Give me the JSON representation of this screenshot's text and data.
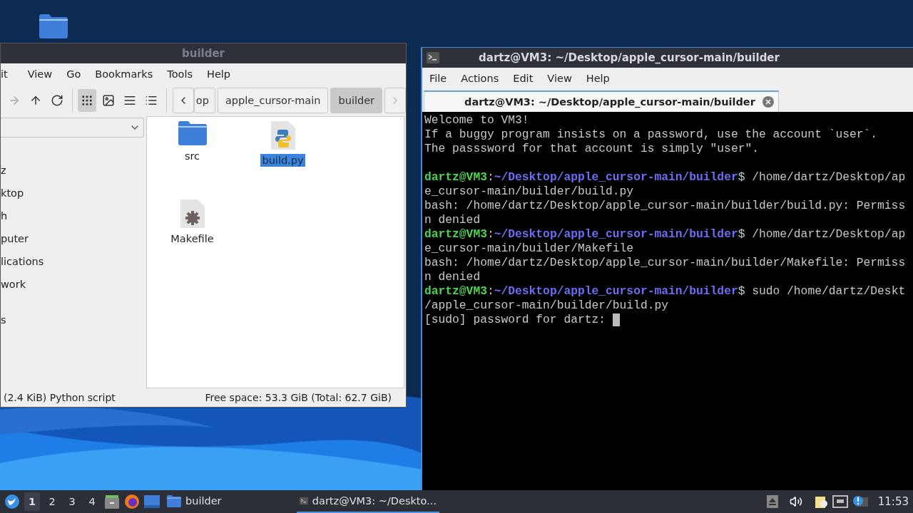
{
  "file_manager": {
    "title": "builder",
    "menu": [
      "it",
      "View",
      "Go",
      "Bookmarks",
      "Tools",
      "Help"
    ],
    "view_modes": [
      {
        "kind": "icons",
        "selected": true
      },
      {
        "kind": "thumbnails",
        "selected": false
      },
      {
        "kind": "list",
        "selected": false
      },
      {
        "kind": "compact",
        "selected": false
      }
    ],
    "path": [
      {
        "label": "op",
        "selected": false
      },
      {
        "label": "apple_cursor-main",
        "selected": false
      },
      {
        "label": "builder",
        "selected": true
      }
    ],
    "sidebar": {
      "items": [
        "z",
        "ktop",
        "h",
        "puter",
        "lications",
        "work",
        "s"
      ]
    },
    "files": [
      {
        "name": "src",
        "kind": "folder",
        "selected": false
      },
      {
        "name": "build.py",
        "kind": "python",
        "selected": true
      },
      {
        "name": "Makefile",
        "kind": "makefile",
        "selected": false
      }
    ],
    "status": {
      "left": "(2.4 KiB) Python script",
      "right": "Free space: 53.3 GiB (Total: 62.7 GiB)"
    }
  },
  "terminal": {
    "title": "dartz@VM3: ~/Desktop/apple_cursor-main/builder",
    "menu": [
      "File",
      "Actions",
      "Edit",
      "View",
      "Help"
    ],
    "tab": "dartz@VM3: ~/Desktop/apple_cursor-main/builder",
    "lines": [
      {
        "kind": "output",
        "text": "Welcome to VM3!"
      },
      {
        "kind": "output",
        "text": "If a buggy program insists on a password, use the account `user`."
      },
      {
        "kind": "output",
        "text": "The passsword for that account is simply \"user\"."
      },
      {
        "kind": "blank"
      },
      {
        "kind": "prompt",
        "user": "dartz@VM3",
        "sep": ":",
        "path": "~/Desktop/apple_cursor-main/builder",
        "text": "$ /home/dartz/Desktop/ap"
      },
      {
        "kind": "output",
        "text": "e_cursor-main/builder/build.py"
      },
      {
        "kind": "output",
        "text": "bash: /home/dartz/Desktop/apple_cursor-main/builder/build.py: Permiss"
      },
      {
        "kind": "output",
        "text": "n denied"
      },
      {
        "kind": "prompt",
        "user": "dartz@VM3",
        "sep": ":",
        "path": "~/Desktop/apple_cursor-main/builder",
        "text": "$ /home/dartz/Desktop/ap"
      },
      {
        "kind": "output",
        "text": "e_cursor-main/builder/Makefile"
      },
      {
        "kind": "output",
        "text": "bash: /home/dartz/Desktop/apple_cursor-main/builder/Makefile: Permiss"
      },
      {
        "kind": "output",
        "text": "n denied"
      },
      {
        "kind": "prompt",
        "user": "dartz@VM3",
        "sep": ":",
        "path": "~/Desktop/apple_cursor-main/builder",
        "text": "$ sudo /home/dartz/Deskt"
      },
      {
        "kind": "output",
        "text": "/apple_cursor-main/builder/build.py"
      },
      {
        "kind": "input",
        "text": "[sudo] password for dartz: "
      }
    ]
  },
  "taskbar": {
    "workspaces": [
      {
        "label": "1",
        "selected": true
      },
      {
        "label": "2",
        "selected": false
      },
      {
        "label": "3",
        "selected": false
      },
      {
        "label": "4",
        "selected": false
      }
    ],
    "tasks": [
      {
        "label": "builder",
        "kind": "folder",
        "selected": false
      },
      {
        "label": "dartz@VM3: ~/Deskto...",
        "kind": "terminal",
        "selected": true
      }
    ],
    "clock": "11:53"
  }
}
